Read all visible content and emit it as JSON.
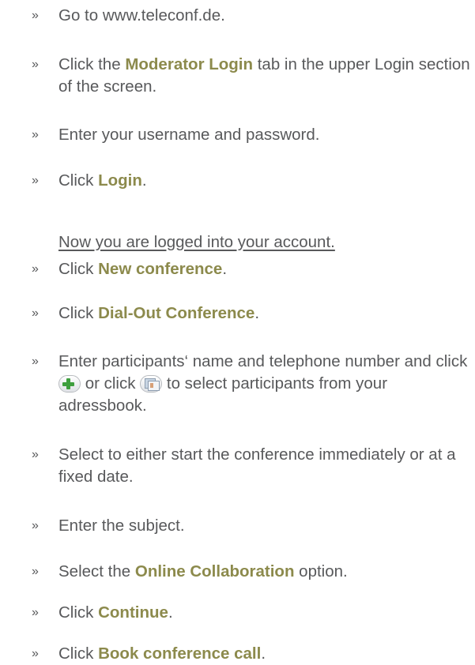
{
  "steps": [
    {
      "bullet": "»",
      "before": "Go to www.teleconf.de.",
      "bold": "",
      "after": ""
    },
    {
      "bullet": "»",
      "before": "Click the ",
      "bold": "Moderator Login",
      "after": " tab in the upper Login section of the screen."
    },
    {
      "bullet": "»",
      "before": "Enter your username and password.",
      "bold": "",
      "after": ""
    },
    {
      "bullet": "»",
      "before": "Click ",
      "bold": "Login",
      "after": "."
    },
    {
      "bullet": "»",
      "before": "Click ",
      "bold": "New conference",
      "after": "."
    },
    {
      "bullet": "»",
      "before": "Click ",
      "bold": "Dial-Out Conference",
      "after": "."
    },
    {
      "bullet": "»",
      "before": "Enter participants‘ name and telephone number and click ",
      "mid": " or click ",
      "after": " to select participants from your adressbook."
    },
    {
      "bullet": "»",
      "before": "Select to either start the conference immediately or at a fixed date.",
      "bold": "",
      "after": ""
    },
    {
      "bullet": "»",
      "before": "Enter the subject.",
      "bold": "",
      "after": ""
    },
    {
      "bullet": "»",
      "before": "Select the ",
      "bold": "Online Collaboration",
      "after": " option."
    },
    {
      "bullet": "»",
      "before": "Click ",
      "bold": "Continue",
      "after": "."
    },
    {
      "bullet": "»",
      "before": "Click ",
      "bold": "Book conference call",
      "after": "."
    }
  ],
  "note": "Now you are logged into your account.",
  "icons": {
    "add": "plus-icon",
    "addressbook": "addressbook-icon",
    "add_color": "#3e9f3e"
  },
  "colors": {
    "text": "#58595b",
    "highlight": "#8c8a4c"
  }
}
